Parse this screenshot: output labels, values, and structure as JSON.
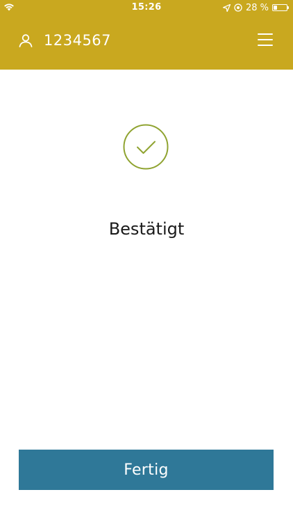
{
  "status_bar": {
    "time": "15:26",
    "battery_text": "28 %",
    "battery_level": 0.28
  },
  "header": {
    "account_number": "1234567",
    "account_icon": "person-icon",
    "menu_icon": "hamburger-menu-icon"
  },
  "colors": {
    "header_bg": "#c9a81f",
    "button_bg": "#2f7898",
    "check_accent": "#8fa330"
  },
  "main": {
    "status_icon": "checkmark-circle-icon",
    "title": "Bestätigt"
  },
  "actions": {
    "done_label": "Fertig"
  }
}
